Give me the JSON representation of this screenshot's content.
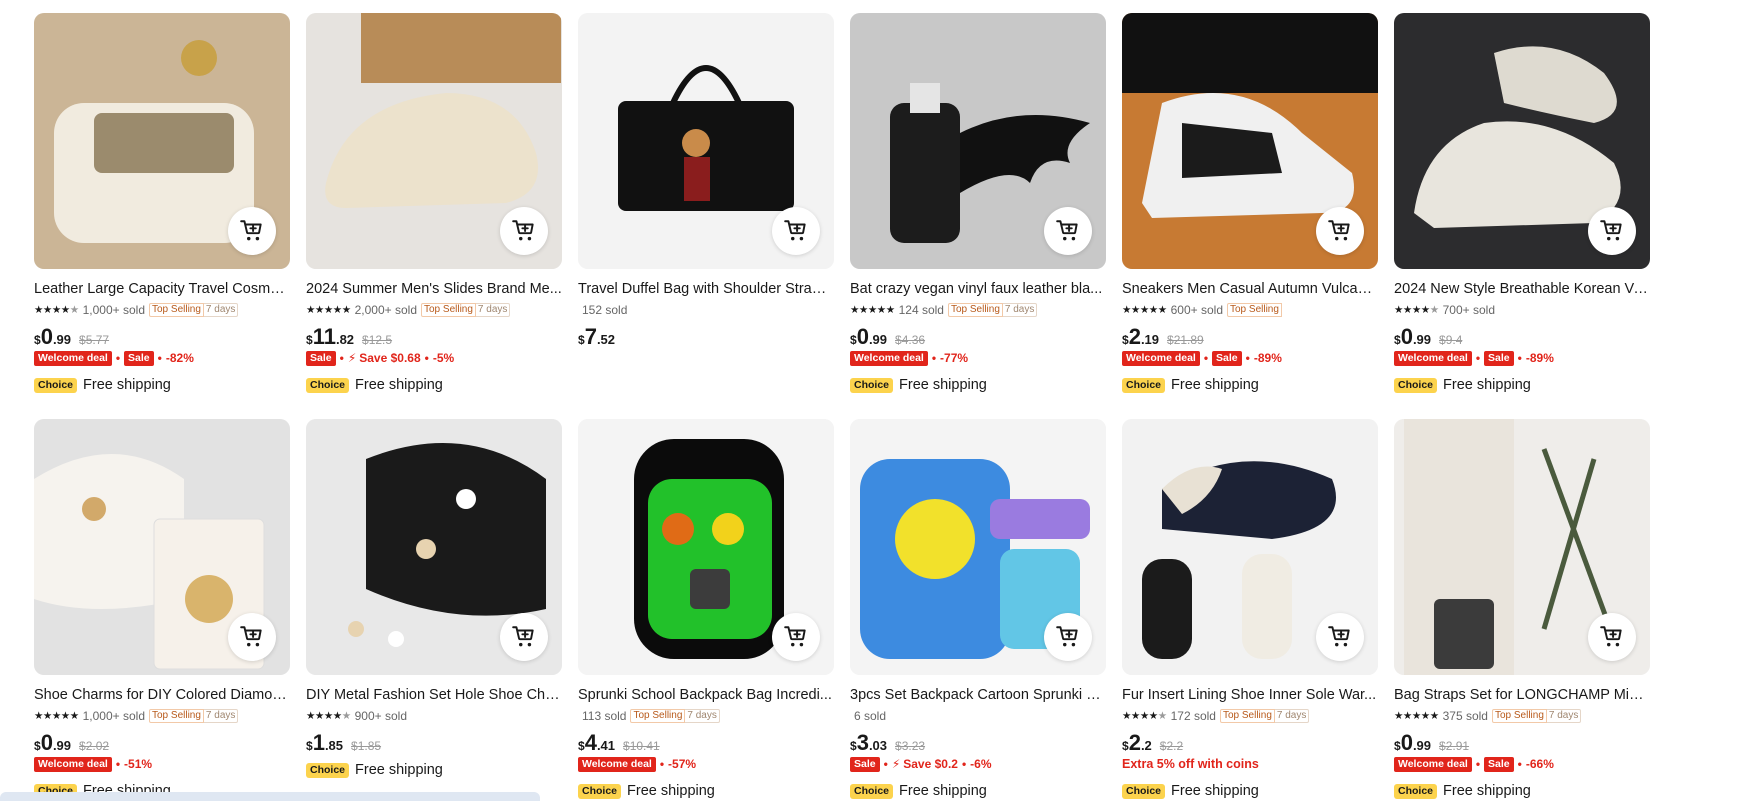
{
  "colors": {
    "accent": "#e1251b",
    "choice": "#fcd34d",
    "star": "#191919"
  },
  "icons": {
    "cart": "add-to-cart-icon",
    "star": "star-icon",
    "flash": "lightning-icon"
  },
  "products": [
    {
      "title": "Leather Large Capacity Travel Cosmet...",
      "rating": 4.5,
      "stars": "★★★★★",
      "sold": "1,000+ sold",
      "top_selling": "Top Selling",
      "days": "7 days",
      "price": {
        "currency": "$",
        "int": "0",
        "dec": ".99",
        "original": "$5.77"
      },
      "deals": [
        {
          "kind": "badge",
          "text": "Welcome deal"
        },
        {
          "kind": "badge",
          "text": "Sale"
        },
        {
          "kind": "text",
          "text": "-82%"
        }
      ],
      "choice": "Choice",
      "shipping": "Free shipping",
      "image": "cosmetic-bag",
      "bg": "#cbb596"
    },
    {
      "title": "2024 Summer Men's Slides Brand Me...",
      "rating": 5,
      "stars": "★★★★★",
      "sold": "2,000+ sold",
      "top_selling": "Top Selling",
      "days": "7 days",
      "price": {
        "currency": "$",
        "int": "11",
        "dec": ".82",
        "original": "$12.5"
      },
      "deals": [
        {
          "kind": "badge",
          "text": "Sale"
        },
        {
          "kind": "save",
          "text": "Save $0.68"
        },
        {
          "kind": "text",
          "text": "-5%"
        }
      ],
      "choice": "Choice",
      "shipping": "Free shipping",
      "image": "slide-sandal",
      "bg": "#e6e3df"
    },
    {
      "title": "Travel Duffel Bag with Shoulder Strap ...",
      "rating": 0,
      "stars": "",
      "sold": "152 sold",
      "top_selling": "",
      "days": "",
      "price": {
        "currency": "$",
        "int": "7",
        "dec": ".52",
        "original": ""
      },
      "deals": [],
      "choice": "",
      "shipping": "",
      "image": "duffel-bag",
      "bg": "#f3f3f3"
    },
    {
      "title": "Bat crazy vegan vinyl faux leather bla...",
      "rating": 5,
      "stars": "★★★★★",
      "sold": "124 sold",
      "top_selling": "Top Selling",
      "days": "7 days",
      "price": {
        "currency": "$",
        "int": "0",
        "dec": ".99",
        "original": "$4.36"
      },
      "deals": [
        {
          "kind": "badge",
          "text": "Welcome deal"
        },
        {
          "kind": "text",
          "text": "-77%"
        }
      ],
      "choice": "Choice",
      "shipping": "Free shipping",
      "image": "bat-lighter-case",
      "bg": "#c8c8c8"
    },
    {
      "title": "Sneakers Men Casual Autumn Vulcani...",
      "rating": 5,
      "stars": "★★★★★",
      "sold": "600+ sold",
      "top_selling": "Top Selling",
      "days": "",
      "price": {
        "currency": "$",
        "int": "2",
        "dec": ".19",
        "original": "$21.89"
      },
      "deals": [
        {
          "kind": "badge",
          "text": "Welcome deal"
        },
        {
          "kind": "badge",
          "text": "Sale"
        },
        {
          "kind": "text",
          "text": "-89%"
        }
      ],
      "choice": "Choice",
      "shipping": "Free shipping",
      "image": "sneakers",
      "bg": "#c77a33"
    },
    {
      "title": "2024 New Style Breathable Korean Ve...",
      "rating": 4.5,
      "stars": "★★★★★",
      "sold": "700+ sold",
      "top_selling": "",
      "days": "",
      "price": {
        "currency": "$",
        "int": "0",
        "dec": ".99",
        "original": "$9.4"
      },
      "deals": [
        {
          "kind": "badge",
          "text": "Welcome deal"
        },
        {
          "kind": "badge",
          "text": "Sale"
        },
        {
          "kind": "text",
          "text": "-89%"
        }
      ],
      "choice": "Choice",
      "shipping": "Free shipping",
      "image": "knit-sneakers",
      "bg": "#2c2c2e"
    },
    {
      "title": "Shoe Charms for DIY Colored Diamon...",
      "rating": 5,
      "stars": "★★★★★",
      "sold": "1,000+ sold",
      "top_selling": "Top Selling",
      "days": "7 days",
      "price": {
        "currency": "$",
        "int": "0",
        "dec": ".99",
        "original": "$2.02"
      },
      "deals": [
        {
          "kind": "badge",
          "text": "Welcome deal"
        },
        {
          "kind": "text",
          "text": "-51%"
        }
      ],
      "choice": "Choice",
      "shipping": "Free shipping",
      "image": "shoe-charms-white",
      "bg": "#e2e2e2"
    },
    {
      "title": "DIY Metal Fashion Set Hole Shoe Char...",
      "rating": 4.5,
      "stars": "★★★★★",
      "sold": "900+ sold",
      "top_selling": "",
      "days": "",
      "price": {
        "currency": "$",
        "int": "1",
        "dec": ".85",
        "original": "$1.85"
      },
      "deals": [],
      "choice": "Choice",
      "shipping": "Free shipping",
      "image": "shoe-charms-black",
      "bg": "#e8e8e8"
    },
    {
      "title": "Sprunki School Backpack Bag Incredi...",
      "rating": 0,
      "stars": "",
      "sold": "113 sold",
      "top_selling": "Top Selling",
      "days": "7 days",
      "price": {
        "currency": "$",
        "int": "4",
        "dec": ".41",
        "original": "$10.41"
      },
      "deals": [
        {
          "kind": "badge",
          "text": "Welcome deal"
        },
        {
          "kind": "text",
          "text": "-57%"
        }
      ],
      "choice": "Choice",
      "shipping": "Free shipping",
      "image": "sprunki-backpack",
      "bg": "#f4f4f4"
    },
    {
      "title": "3pcs Set Backpack Cartoon Sprunki S...",
      "rating": 0,
      "stars": "",
      "sold": "6 sold",
      "top_selling": "",
      "days": "",
      "price": {
        "currency": "$",
        "int": "3",
        "dec": ".03",
        "original": "$3.23"
      },
      "deals": [
        {
          "kind": "badge",
          "text": "Sale"
        },
        {
          "kind": "save",
          "text": "Save $0.2"
        },
        {
          "kind": "text",
          "text": "-6%"
        }
      ],
      "choice": "Choice",
      "shipping": "Free shipping",
      "image": "sprunki-set",
      "bg": "#f4f4f4"
    },
    {
      "title": "Fur Insert Lining Shoe Inner Sole War...",
      "rating": 4.5,
      "stars": "★★★★★",
      "sold": "172 sold",
      "top_selling": "Top Selling",
      "days": "7 days",
      "price": {
        "currency": "$",
        "int": "2",
        "dec": ".2",
        "original": "$2.2"
      },
      "deals": [
        {
          "kind": "coins",
          "text": "Extra 5% off with coins"
        }
      ],
      "choice": "Choice",
      "shipping": "Free shipping",
      "image": "fur-clogs",
      "bg": "#f2f2f2"
    },
    {
      "title": "Bag Straps Set for LONGCHAMP Mini ...",
      "rating": 5,
      "stars": "★★★★★",
      "sold": "375 sold",
      "top_selling": "Top Selling",
      "days": "7 days",
      "price": {
        "currency": "$",
        "int": "0",
        "dec": ".99",
        "original": "$2.91"
      },
      "deals": [
        {
          "kind": "badge",
          "text": "Welcome deal"
        },
        {
          "kind": "badge",
          "text": "Sale"
        },
        {
          "kind": "text",
          "text": "-66%"
        }
      ],
      "choice": "Choice",
      "shipping": "Free shipping",
      "image": "bag-straps",
      "bg": "#efedea"
    }
  ]
}
